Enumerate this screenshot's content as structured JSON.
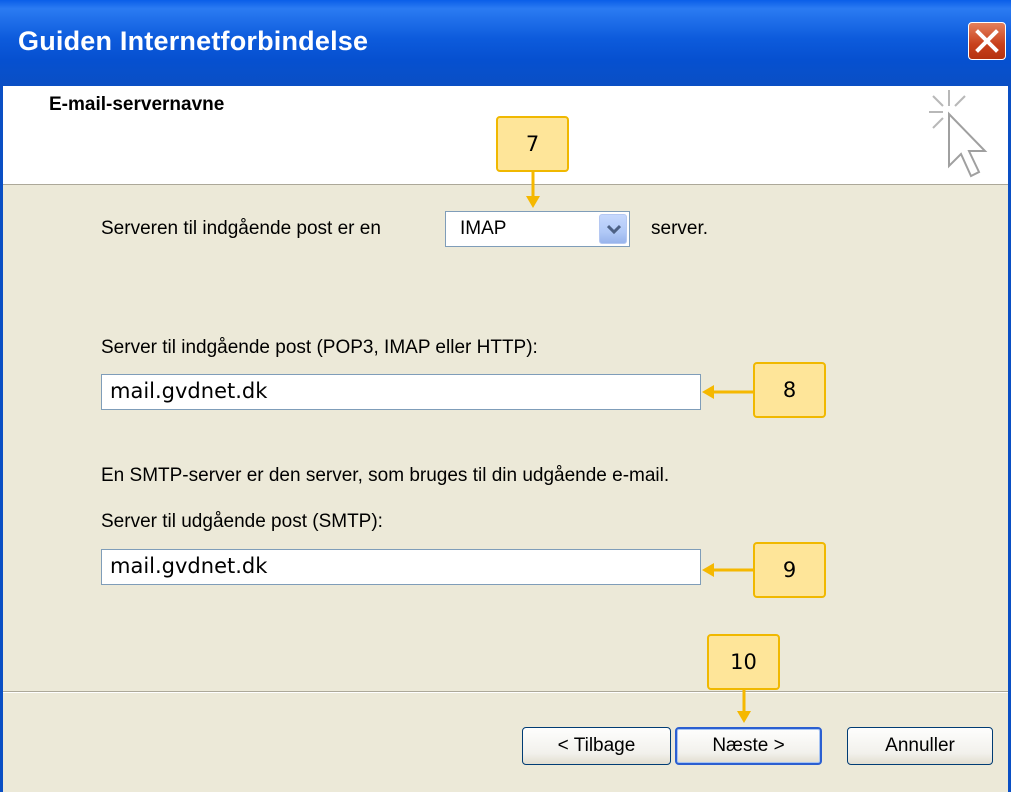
{
  "window": {
    "title": "Guiden Internetforbindelse"
  },
  "header": {
    "title": "E-mail-servernavne"
  },
  "incoming_type": {
    "label": "Serveren til indgående post er en",
    "selected": "IMAP",
    "suffix": "server."
  },
  "incoming_server": {
    "label": "Server til indgående post (POP3, IMAP eller HTTP):",
    "value": "mail.gvdnet.dk"
  },
  "smtp_info": "En SMTP-server er den server, som bruges til din udgående e-mail.",
  "outgoing_server": {
    "label": "Server til udgående post (SMTP):",
    "value": "mail.gvdnet.dk"
  },
  "buttons": {
    "back": "< Tilbage",
    "next": "Næste >",
    "cancel": "Annuller"
  },
  "callouts": [
    "7",
    "8",
    "9",
    "10"
  ],
  "colors": {
    "callout_fill": "#fee599",
    "callout_border": "#f0b800",
    "titlebar": "#0a5ee8"
  }
}
